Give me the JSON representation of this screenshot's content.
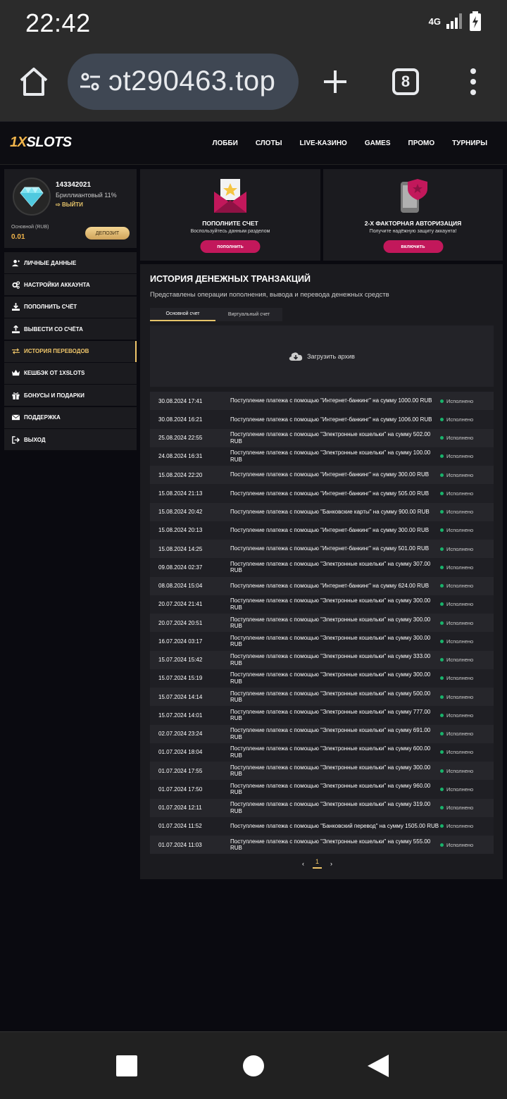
{
  "status_bar": {
    "time": "22:42",
    "network": "4G"
  },
  "browser": {
    "url": "ɔt290463.top",
    "tab_count": "8"
  },
  "site": {
    "logo_a": "1X",
    "logo_b": "SLOTS",
    "nav": [
      "ЛОББИ",
      "СЛОТЫ",
      "LIVE-КАЗИНО",
      "GAMES",
      "ПРОМО",
      "ТУРНИРЫ"
    ]
  },
  "profile": {
    "user_id": "143342021",
    "rank": "Бриллиантовый 11%",
    "logout": "ВЫЙТИ",
    "account_label": "Основной (RUB)",
    "balance": "0.01",
    "deposit_button": "ДЕПОЗИТ"
  },
  "menu": [
    {
      "label": "ЛИЧНЫЕ ДАННЫЕ",
      "icon": "user-plus-icon"
    },
    {
      "label": "НАСТРОЙКИ АККАУНТА",
      "icon": "gears-icon"
    },
    {
      "label": "ПОПОЛНИТЬ СЧЁТ",
      "icon": "download-icon"
    },
    {
      "label": "ВЫВЕСТИ СО СЧЁТА",
      "icon": "upload-icon"
    },
    {
      "label": "ИСТОРИЯ ПЕРЕВОДОВ",
      "icon": "exchange-icon"
    },
    {
      "label": "КЕШБЭК ОТ 1XSLOTS",
      "icon": "crown-icon"
    },
    {
      "label": "БОНУСЫ И ПОДАРКИ",
      "icon": "gift-icon"
    },
    {
      "label": "ПОДДЕРЖКА",
      "icon": "envelope-icon"
    },
    {
      "label": "ВЫХОД",
      "icon": "sign-out-icon"
    }
  ],
  "cards": {
    "deposit": {
      "title": "ПОПОЛНИТЕ СЧЕТ",
      "subtitle": "Воспользуйтесь данным разделом",
      "button": "пополнить"
    },
    "twofa": {
      "title": "2-Х ФАКТОРНАЯ АВТОРИЗАЦИЯ",
      "subtitle": "Получите надёжную защиту аккаунта!",
      "button": "включить"
    }
  },
  "history": {
    "title": "ИСТОРИЯ ДЕНЕЖНЫХ ТРАНЗАКЦИЙ",
    "subtitle": "Представлены операции пополнения, вывода и перевода денежных средств",
    "tabs": [
      "Основной счет",
      "Виртуальный счет"
    ],
    "archive": "Загрузить архив",
    "rows": [
      {
        "date": "30.08.2024 17:41",
        "desc": "Поступление платежа с помощью \"Интернет-банкинг\" на сумму 1000.00 RUB",
        "status": "Исполнено"
      },
      {
        "date": "30.08.2024 16:21",
        "desc": "Поступление платежа с помощью \"Интернет-банкинг\" на сумму 1006.00 RUB",
        "status": "Исполнено"
      },
      {
        "date": "25.08.2024 22:55",
        "desc": "Поступление платежа с помощью \"Электронные кошельки\" на сумму 502.00 RUB",
        "status": "Исполнено"
      },
      {
        "date": "24.08.2024 16:31",
        "desc": "Поступление платежа с помощью \"Электронные кошельки\" на сумму 100.00 RUB",
        "status": "Исполнено"
      },
      {
        "date": "15.08.2024 22:20",
        "desc": "Поступление платежа с помощью \"Интернет-банкинг\" на сумму 300.00 RUB",
        "status": "Исполнено"
      },
      {
        "date": "15.08.2024 21:13",
        "desc": "Поступление платежа с помощью \"Интернет-банкинг\" на сумму 505.00 RUB",
        "status": "Исполнено"
      },
      {
        "date": "15.08.2024 20:42",
        "desc": "Поступление платежа с помощью \"Банковские карты\" на сумму 900.00 RUB",
        "status": "Исполнено"
      },
      {
        "date": "15.08.2024 20:13",
        "desc": "Поступление платежа с помощью \"Интернет-банкинг\" на сумму 300.00 RUB",
        "status": "Исполнено"
      },
      {
        "date": "15.08.2024 14:25",
        "desc": "Поступление платежа с помощью \"Интернет-банкинг\" на сумму 501.00 RUB",
        "status": "Исполнено"
      },
      {
        "date": "09.08.2024 02:37",
        "desc": "Поступление платежа с помощью \"Электронные кошельки\" на сумму 307.00 RUB",
        "status": "Исполнено"
      },
      {
        "date": "08.08.2024 15:04",
        "desc": "Поступление платежа с помощью \"Интернет-банкинг\" на сумму 624.00 RUB",
        "status": "Исполнено"
      },
      {
        "date": "20.07.2024 21:41",
        "desc": "Поступление платежа с помощью \"Электронные кошельки\" на сумму 300.00 RUB",
        "status": "Исполнено"
      },
      {
        "date": "20.07.2024 20:51",
        "desc": "Поступление платежа с помощью \"Электронные кошельки\" на сумму 300.00 RUB",
        "status": "Исполнено"
      },
      {
        "date": "16.07.2024 03:17",
        "desc": "Поступление платежа с помощью \"Электронные кошельки\" на сумму 300.00 RUB",
        "status": "Исполнено"
      },
      {
        "date": "15.07.2024 15:42",
        "desc": "Поступление платежа с помощью \"Электронные кошельки\" на сумму 333.00 RUB",
        "status": "Исполнено"
      },
      {
        "date": "15.07.2024 15:19",
        "desc": "Поступление платежа с помощью \"Электронные кошельки\" на сумму 300.00 RUB",
        "status": "Исполнено"
      },
      {
        "date": "15.07.2024 14:14",
        "desc": "Поступление платежа с помощью \"Электронные кошельки\" на сумму 500.00 RUB",
        "status": "Исполнено"
      },
      {
        "date": "15.07.2024 14:01",
        "desc": "Поступление платежа с помощью \"Электронные кошельки\" на сумму 777.00 RUB",
        "status": "Исполнено"
      },
      {
        "date": "02.07.2024 23:24",
        "desc": "Поступление платежа с помощью \"Электронные кошельки\" на сумму 691.00 RUB",
        "status": "Исполнено"
      },
      {
        "date": "01.07.2024 18:04",
        "desc": "Поступление платежа с помощью \"Электронные кошельки\" на сумму 600.00 RUB",
        "status": "Исполнено"
      },
      {
        "date": "01.07.2024 17:55",
        "desc": "Поступление платежа с помощью \"Электронные кошельки\" на сумму 300.00 RUB",
        "status": "Исполнено"
      },
      {
        "date": "01.07.2024 17:50",
        "desc": "Поступление платежа с помощью \"Электронные кошельки\" на сумму 960.00 RUB",
        "status": "Исполнено"
      },
      {
        "date": "01.07.2024 12:11",
        "desc": "Поступление платежа с помощью \"Электронные кошельки\" на сумму 319.00 RUB",
        "status": "Исполнено"
      },
      {
        "date": "01.07.2024 11:52",
        "desc": "Поступление платежа с помощью \"Банковский перевод\" на сумму 1505.00 RUB",
        "status": "Исполнено"
      },
      {
        "date": "01.07.2024 11:03",
        "desc": "Поступление платежа с помощью \"Электронные кошельки\" на сумму 555.00 RUB",
        "status": "Исполнено"
      }
    ],
    "pagination": {
      "prev": "‹",
      "page": "1",
      "next": "›"
    }
  },
  "colors": {
    "accent": "#f0c66a",
    "brand": "#f0b44b",
    "button": "#c2185b",
    "status_ok": "#19b36b"
  }
}
